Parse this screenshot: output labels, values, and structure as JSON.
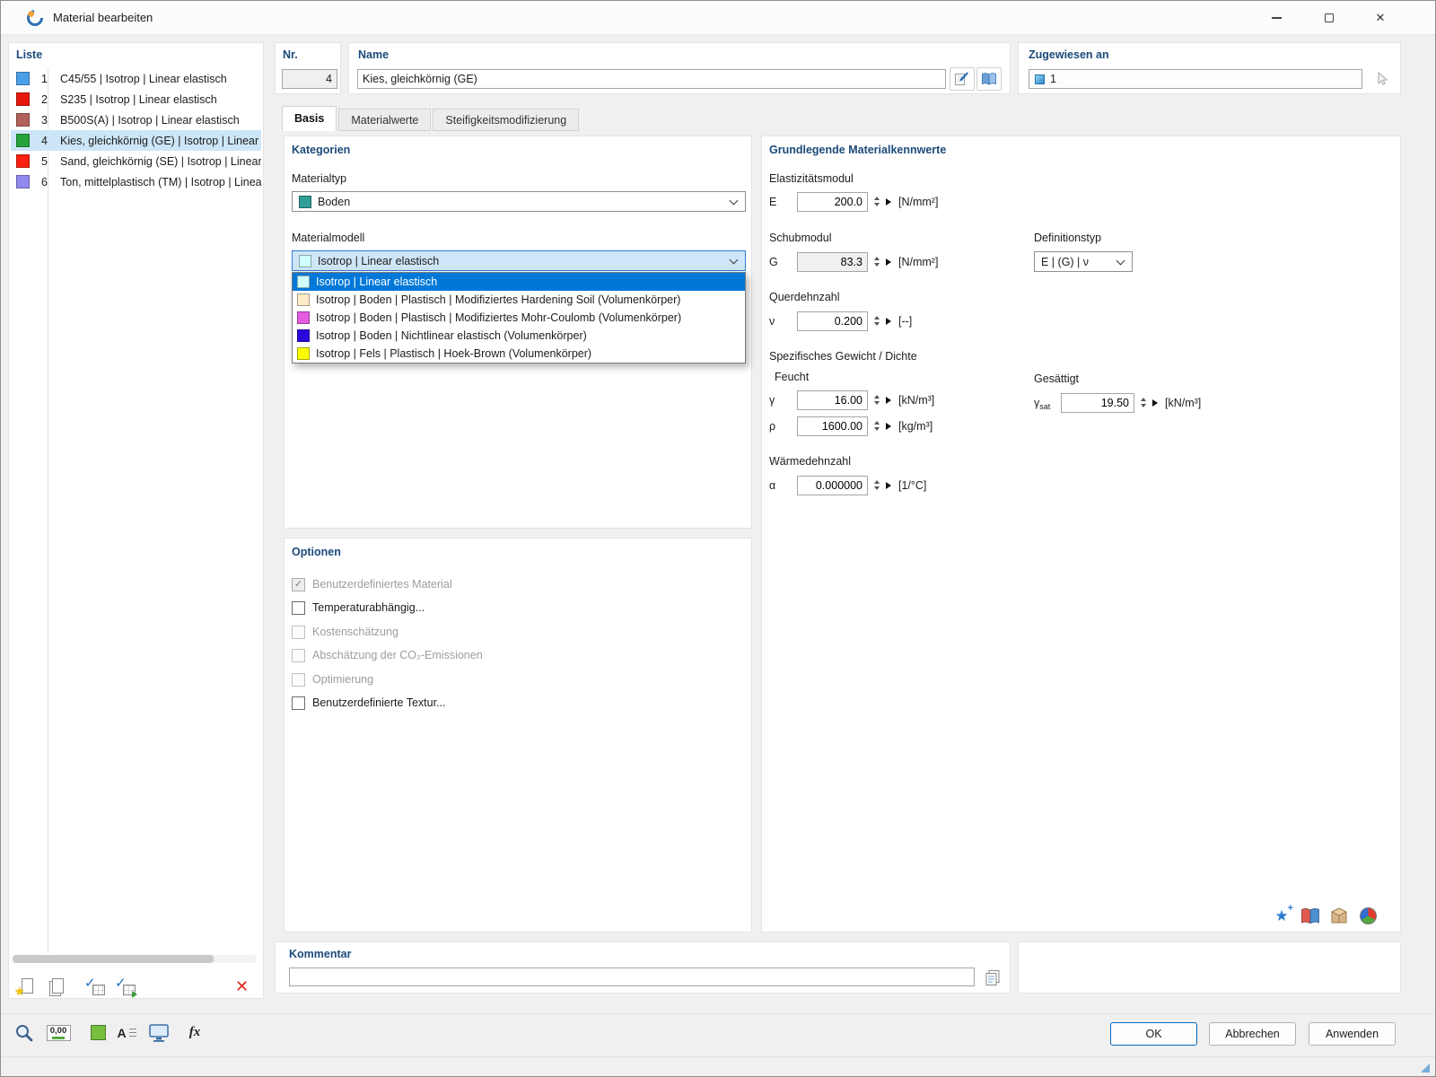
{
  "colors": {
    "accent": "#0067c0",
    "selection": "#0078d7",
    "group_title": "#1b4a7a",
    "list_selected_bg": "#cde6f7"
  },
  "icons": {
    "check": "✓",
    "close": "✕",
    "delete": "✕",
    "star": "★",
    "plus": "+",
    "fx": "fx",
    "decimal": "0,00",
    "font_a": "A"
  },
  "window": {
    "title": "Material bearbeiten"
  },
  "liste": {
    "title": "Liste",
    "items": [
      {
        "nr": "1",
        "label": "C45/55 | Isotrop | Linear elastisch",
        "color": "#4aa0e8"
      },
      {
        "nr": "2",
        "label": "S235 | Isotrop | Linear elastisch",
        "color": "#e8170c"
      },
      {
        "nr": "3",
        "label": "B500S(A) | Isotrop | Linear elastisch",
        "color": "#b2625a"
      },
      {
        "nr": "4",
        "label": "Kies, gleichkörnig (GE) | Isotrop | Linear elastisch",
        "color": "#24a43b"
      },
      {
        "nr": "5",
        "label": "Sand, gleichkörnig (SE) | Isotrop | Linear elastisch",
        "color": "#fb2012"
      },
      {
        "nr": "6",
        "label": "Ton, mittelplastisch (TM) | Isotrop | Linear elastisch",
        "color": "#9289f0"
      }
    ]
  },
  "header": {
    "nr": {
      "label": "Nr.",
      "value": "4"
    },
    "name": {
      "label": "Name",
      "value": "Kies, gleichkörnig (GE)"
    },
    "zugewiesen": {
      "label": "Zugewiesen an",
      "value": "1"
    }
  },
  "tabs": [
    {
      "label": "Basis"
    },
    {
      "label": "Materialwerte"
    },
    {
      "label": "Steifigkeitsmodifizierung"
    }
  ],
  "kategorien": {
    "title": "Kategorien",
    "materialtyp": {
      "label": "Materialtyp",
      "value": "Boden",
      "swatch": "#2e9e96"
    },
    "materialmodell": {
      "label": "Materialmodell",
      "value": "Isotrop | Linear elastisch",
      "swatch": "#cfffff"
    },
    "dropdown": [
      {
        "label": "Isotrop | Linear elastisch",
        "swatch": "#cfffff"
      },
      {
        "label": "Isotrop | Boden | Plastisch | Modifiziertes Hardening Soil (Volumenkörper)",
        "swatch": "#ffedc9"
      },
      {
        "label": "Isotrop | Boden | Plastisch | Modifiziertes Mohr-Coulomb (Volumenkörper)",
        "swatch": "#e45be0"
      },
      {
        "label": "Isotrop | Boden | Nichtlinear elastisch (Volumenkörper)",
        "swatch": "#2b07dd"
      },
      {
        "label": "Isotrop | Fels | Plastisch | Hoek-Brown (Volumenkörper)",
        "swatch": "#fdfd00"
      }
    ]
  },
  "optionen": {
    "title": "Optionen",
    "items": [
      {
        "label": "Benutzerdefiniertes Material",
        "checked": true,
        "enabled": false
      },
      {
        "label": "Temperaturabhängig...",
        "checked": false,
        "enabled": true
      },
      {
        "label": "Kostenschätzung",
        "checked": false,
        "enabled": false
      },
      {
        "label": "Abschätzung der CO₂-Emissionen",
        "checked": false,
        "enabled": false
      },
      {
        "label": "Optimierung",
        "checked": false,
        "enabled": false
      },
      {
        "label": "Benutzerdefinierte Textur...",
        "checked": false,
        "enabled": true
      }
    ]
  },
  "kennwerte": {
    "title": "Grundlegende Materialkennwerte",
    "elastizitaet": {
      "label": "Elastizitätsmodul",
      "symbol": "E",
      "value": "200.0",
      "unit": "[N/mm²]"
    },
    "schubmodul": {
      "label": "Schubmodul",
      "symbol": "G",
      "value": "83.3",
      "unit": "[N/mm²]"
    },
    "definitionstyp": {
      "label": "Definitionstyp",
      "value": "E | (G) | ν"
    },
    "querdehnzahl": {
      "label": "Querdehnzahl",
      "symbol": "ν",
      "value": "0.200",
      "unit": "[--]"
    },
    "gewicht": {
      "label": "Spezifisches Gewicht / Dichte",
      "feucht_label": "Feucht",
      "gesaettigt_label": "Gesättigt",
      "gamma": {
        "symbol": "γ",
        "value": "16.00",
        "unit": "[kN/m³]"
      },
      "rho": {
        "symbol": "ρ",
        "value": "1600.00",
        "unit": "[kg/m³]"
      },
      "gamma_sat": {
        "symbol": "γ",
        "symbol_sub": "sat",
        "value": "19.50",
        "unit": "[kN/m³]"
      }
    },
    "waermedehnzahl": {
      "label": "Wärmedehnzahl",
      "symbol": "α",
      "value": "0.000000",
      "unit": "[1/°C]"
    }
  },
  "kommentar": {
    "title": "Kommentar",
    "value": ""
  },
  "footer": {
    "ok": "OK",
    "abbrechen": "Abbrechen",
    "anwenden": "Anwenden"
  }
}
